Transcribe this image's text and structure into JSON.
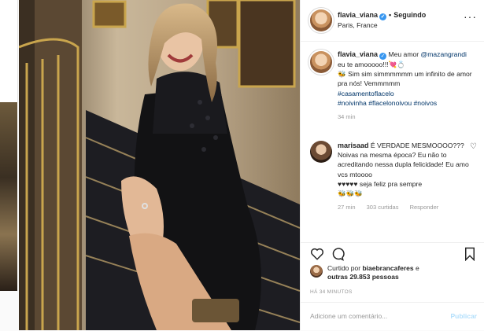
{
  "post": {
    "username": "flavia_viana",
    "follow_dot": "•",
    "follow_label": "Seguindo",
    "location": "Paris, France",
    "more": "···"
  },
  "caption": {
    "username": "flavia_viana",
    "text_before": "Meu amor",
    "mention": "@mazangrandi",
    "text_mid": "eu te amooooo!!!💘💍",
    "line2": "🐝 Sim sim simmmmmm um infinito de amor pra nós! Vemmmmm",
    "tag1": "#casamentoflacelo",
    "tag2": "#noivinha",
    "tag3": "#flacelonoivou",
    "tag4": "#noivos",
    "time": "34 min"
  },
  "comment": {
    "username": "marisaad",
    "text": "É VERDADE MESMOOOO??? Noivas na mesma época? Eu não to acreditando nessa dupla felicidade! Eu amo vcs mtoooo",
    "text2": "♥♥♥♥♥ seja feliz pra sempre",
    "text3": "🐝🐝🐝",
    "time": "27 min",
    "likes": "303 curtidas",
    "reply": "Responder"
  },
  "likes": {
    "prefix": "Curtido por",
    "user": "biaebrancaferes",
    "mid": "e",
    "others": "outras 29.853 pessoas"
  },
  "age": "HÁ 34 MINUTOS",
  "add_comment": {
    "placeholder": "Adicione um comentário...",
    "publish": "Publicar"
  },
  "colors": {
    "link": "#003569",
    "verified": "#3897f0",
    "muted": "#999999"
  }
}
